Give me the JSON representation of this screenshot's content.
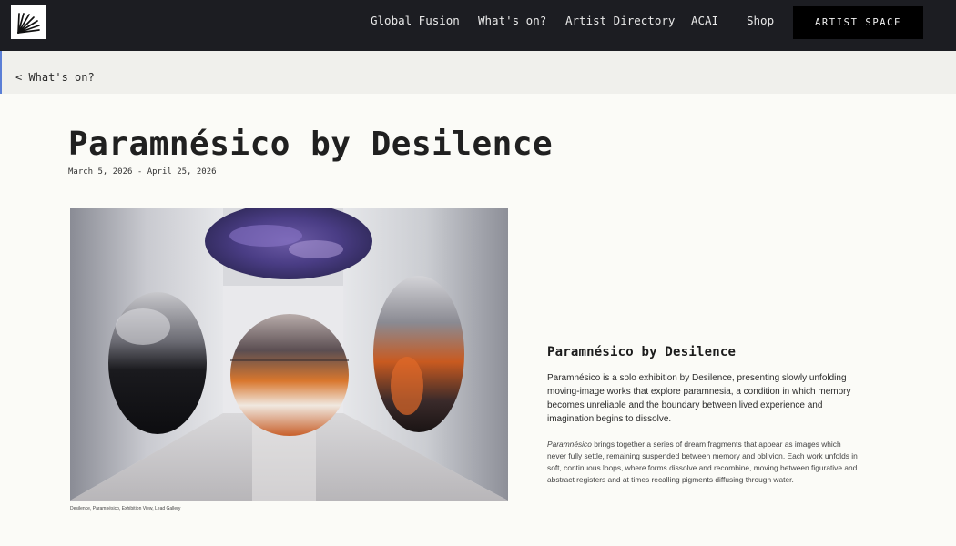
{
  "nav": {
    "logo_name": "sunburst-logo",
    "items": [
      "Global Fusion",
      "What's on?",
      "Artist Directory",
      "ACAI",
      "Shop"
    ],
    "cta": "ARTIST SPACE"
  },
  "breadcrumb": "< What's on?",
  "exhibition": {
    "title": "Paramnésico by Desilence",
    "dates": "March 5, 2026 - April 25, 2026",
    "caption": "Desilence, Paramnésico, Exhibition View, Lead Gallery",
    "subtitle": "Paramnésico by Desilence",
    "paragraph1": "Paramnésico is a solo exhibition by Desilence, presenting slowly unfolding moving-image works that explore paramnesia, a condition in which memory becomes unreliable and the boundary between lived experience and imagination begins to dissolve.",
    "paragraph2_em": "Paramnésico",
    "paragraph2_rest": " brings together a series of dream fragments that appear as images which never fully settle, remaining suspended between memory and oblivion. Each work unfolds in soft, continuous loops, where forms dissolve and recombine, moving between figurative and abstract registers and at times recalling pigments diffusing through water."
  },
  "colors": {
    "topbar": "#1c1d22",
    "cta_bg": "#000000",
    "breadcrumb_bg": "#f0f0ec",
    "page_bg": "#fbfbf7"
  }
}
